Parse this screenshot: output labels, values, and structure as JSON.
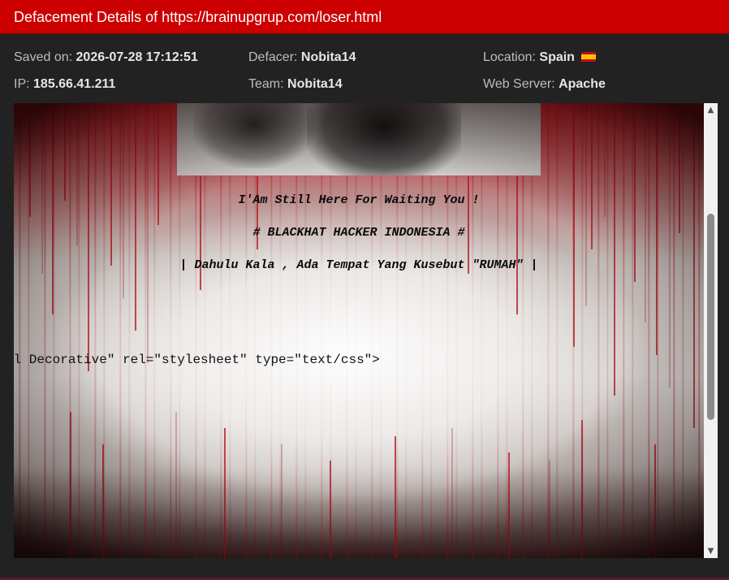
{
  "window": {
    "title": "Defacement Details of https://brainupgrup.com/loser.html"
  },
  "meta": {
    "saved_on_label": "Saved on:",
    "saved_on_value": "2026-07-28 17:12:51",
    "defacer_label": "Defacer:",
    "defacer_value": "Nobita14",
    "location_label": "Location:",
    "location_value": "Spain",
    "ip_label": "IP:",
    "ip_value": "185.66.41.211",
    "team_label": "Team:",
    "team_value": "Nobita14",
    "webserver_label": "Web Server:",
    "webserver_value": "Apache"
  },
  "page": {
    "line1": "I'Am Still Here For Waiting You !",
    "line2": "# BLACKHAT HACKER INDONESIA #",
    "line3": "| Dahulu Kala , Ada Tempat Yang Kusebut \"RUMAH\" |",
    "code": "el Decorative\" rel=\"stylesheet\" type=\"text/css\">"
  },
  "colors": {
    "titlebar": "#cc0000",
    "background": "#222222",
    "blood": "#b01820"
  },
  "icons": {
    "flag": "spain-flag-icon",
    "scroll_up": "triangle-up",
    "scroll_down": "triangle-down"
  }
}
